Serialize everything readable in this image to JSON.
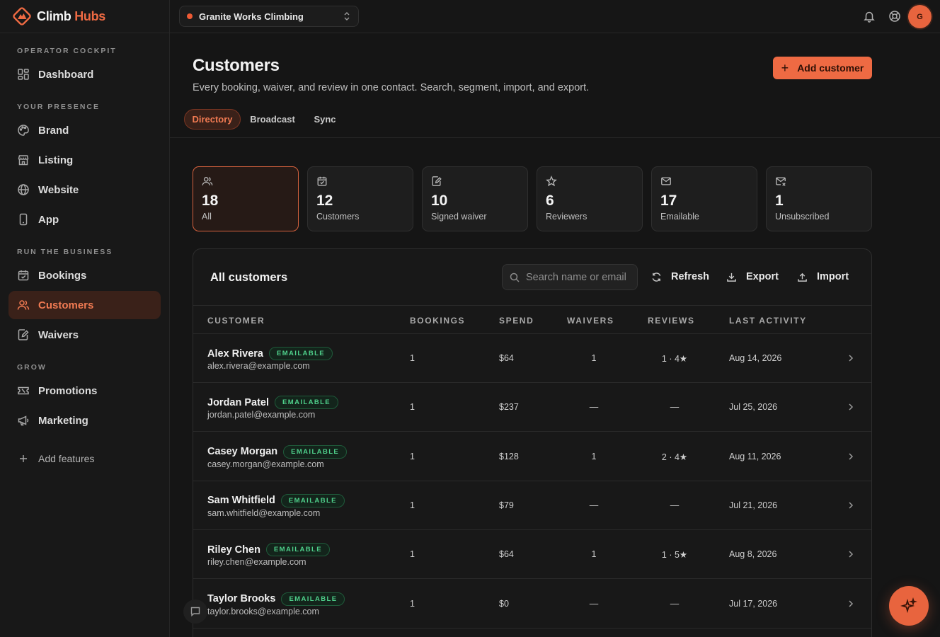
{
  "brand": {
    "name_part1": "Climb",
    "name_part2": "Hubs",
    "accent": "#ee6a43",
    "logo_icon": "mountain-diamond-icon"
  },
  "sidebar": {
    "sections": [
      {
        "label": "OPERATOR COCKPIT"
      },
      {
        "label": "YOUR PRESENCE"
      },
      {
        "label": "RUN THE BUSINESS"
      },
      {
        "label": "GROW"
      }
    ],
    "items": [
      {
        "label": "Dashboard",
        "icon": "dashboard-icon"
      },
      {
        "label": "Brand",
        "icon": "palette-icon"
      },
      {
        "label": "Listing",
        "icon": "store-icon"
      },
      {
        "label": "Website",
        "icon": "globe-icon"
      },
      {
        "label": "App",
        "icon": "phone-icon"
      },
      {
        "label": "Bookings",
        "icon": "calendar-check-icon"
      },
      {
        "label": "Customers",
        "icon": "users-icon",
        "active": true
      },
      {
        "label": "Waivers",
        "icon": "file-signature-icon"
      },
      {
        "label": "Promotions",
        "icon": "ticket-icon"
      },
      {
        "label": "Marketing",
        "icon": "megaphone-icon"
      }
    ],
    "add_features": "Add features"
  },
  "topbar": {
    "org_name": "Granite Works Climbing",
    "org_status_color": "#ee5a34",
    "avatar_initial": "G"
  },
  "header": {
    "title": "Customers",
    "subtitle": "Every booking, waiver, and review in one contact. Search, segment, import, and export.",
    "add_button": "Add customer",
    "tabs": [
      {
        "label": "Directory",
        "active": true
      },
      {
        "label": "Broadcast"
      },
      {
        "label": "Sync"
      }
    ]
  },
  "stats": [
    {
      "value": "18",
      "label": "All",
      "icon": "users-icon",
      "active": true
    },
    {
      "value": "12",
      "label": "Customers",
      "icon": "calendar-check-icon"
    },
    {
      "value": "10",
      "label": "Signed waiver",
      "icon": "file-signature-icon"
    },
    {
      "value": "6",
      "label": "Reviewers",
      "icon": "star-icon"
    },
    {
      "value": "17",
      "label": "Emailable",
      "icon": "mail-icon"
    },
    {
      "value": "1",
      "label": "Unsubscribed",
      "icon": "mail-x-icon"
    }
  ],
  "table": {
    "title": "All customers",
    "search_placeholder": "Search name or email",
    "refresh": "Refresh",
    "export": "Export",
    "import": "Import",
    "columns": [
      "CUSTOMER",
      "BOOKINGS",
      "SPEND",
      "WAIVERS",
      "REVIEWS",
      "LAST ACTIVITY"
    ],
    "rows": [
      {
        "name": "Alex Rivera",
        "badge": "EMAILABLE",
        "email": "alex.rivera@example.com",
        "bookings": "1",
        "spend": "$64",
        "waivers": "1",
        "reviews": "1 · 4★",
        "last_activity": "Aug 14, 2026"
      },
      {
        "name": "Jordan Patel",
        "badge": "EMAILABLE",
        "email": "jordan.patel@example.com",
        "bookings": "1",
        "spend": "$237",
        "waivers": "—",
        "reviews": "—",
        "last_activity": "Jul 25, 2026"
      },
      {
        "name": "Casey Morgan",
        "badge": "EMAILABLE",
        "email": "casey.morgan@example.com",
        "bookings": "1",
        "spend": "$128",
        "waivers": "1",
        "reviews": "2 · 4★",
        "last_activity": "Aug 11, 2026"
      },
      {
        "name": "Sam Whitfield",
        "badge": "EMAILABLE",
        "email": "sam.whitfield@example.com",
        "bookings": "1",
        "spend": "$79",
        "waivers": "—",
        "reviews": "—",
        "last_activity": "Jul 21, 2026"
      },
      {
        "name": "Riley Chen",
        "badge": "EMAILABLE",
        "email": "riley.chen@example.com",
        "bookings": "1",
        "spend": "$64",
        "waivers": "1",
        "reviews": "1 · 5★",
        "last_activity": "Aug 8, 2026"
      },
      {
        "name": "Taylor Brooks",
        "badge": "EMAILABLE",
        "email": "taylor.brooks@example.com",
        "bookings": "1",
        "spend": "$0",
        "waivers": "—",
        "reviews": "—",
        "last_activity": "Jul 17, 2026"
      }
    ]
  },
  "floating": {
    "chat_icon": "chat-icon",
    "assistant_icon": "sparkles-icon"
  }
}
